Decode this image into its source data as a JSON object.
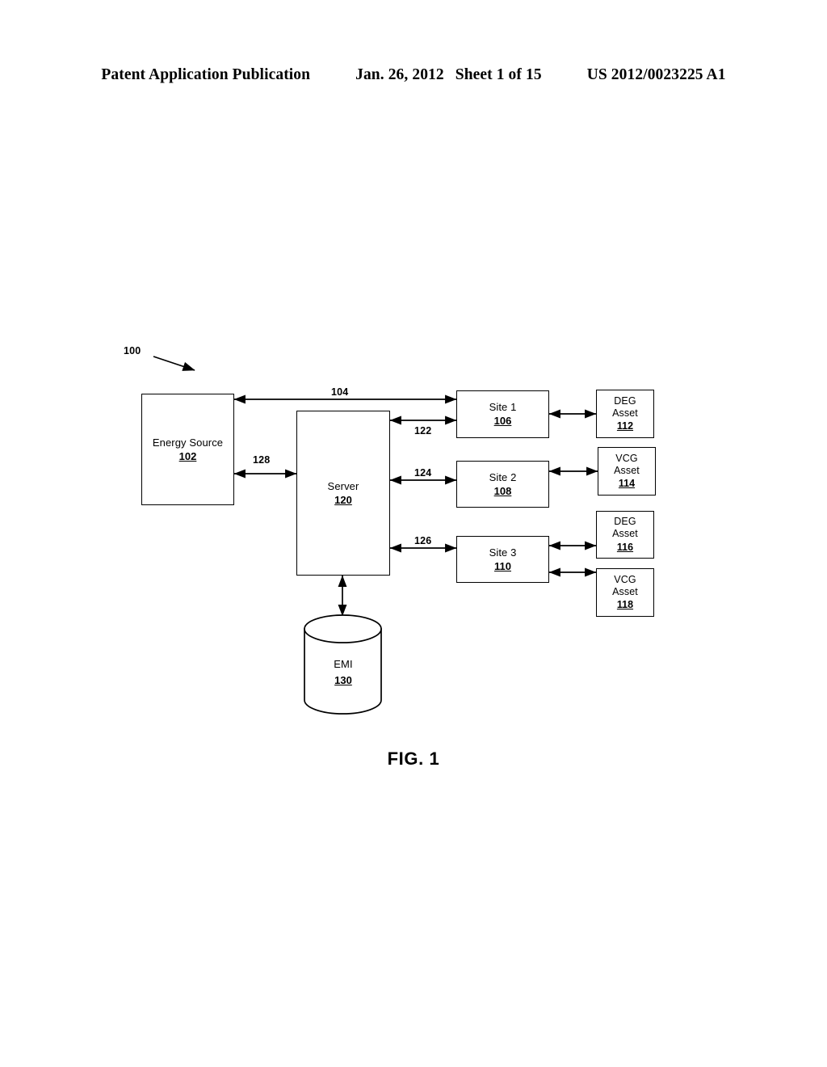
{
  "header": {
    "publication": "Patent Application Publication",
    "date": "Jan. 26, 2012",
    "sheet": "Sheet 1 of 15",
    "patent_number": "US 2012/0023225 A1"
  },
  "figure": {
    "caption": "FIG. 1",
    "system_ref": "100"
  },
  "nodes": {
    "energy_source": {
      "label": "Energy Source",
      "ref": "102"
    },
    "server": {
      "label": "Server",
      "ref": "120"
    },
    "emi": {
      "label": "EMI",
      "ref": "130"
    },
    "site1": {
      "label": "Site 1",
      "ref": "106"
    },
    "site2": {
      "label": "Site 2",
      "ref": "108"
    },
    "site3": {
      "label": "Site 3",
      "ref": "110"
    },
    "deg_asset_112": {
      "label_line1": "DEG",
      "label_line2": "Asset",
      "ref": "112"
    },
    "vcg_asset_114": {
      "label_line1": "VCG",
      "label_line2": "Asset",
      "ref": "114"
    },
    "deg_asset_116": {
      "label_line1": "DEG",
      "label_line2": "Asset",
      "ref": "116"
    },
    "vcg_asset_118": {
      "label_line1": "VCG",
      "label_line2": "Asset",
      "ref": "118"
    }
  },
  "connectors": {
    "energy_to_site1": "104",
    "server_to_site1": "122",
    "server_to_site2": "124",
    "server_to_site3": "126",
    "energy_to_server": "128"
  },
  "colors": {
    "ink": "#000000",
    "paper": "#ffffff"
  }
}
